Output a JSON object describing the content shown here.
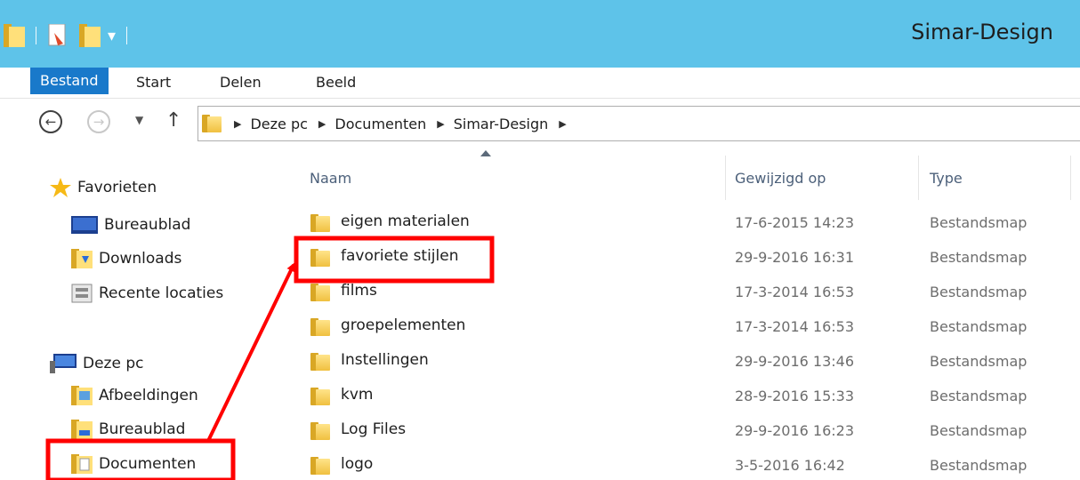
{
  "window": {
    "title": "Simar-Design"
  },
  "ribbon": {
    "tabs": [
      "Bestand",
      "Start",
      "Delen",
      "Beeld"
    ]
  },
  "address": {
    "crumbs": [
      "Deze pc",
      "Documenten",
      "Simar-Design"
    ]
  },
  "navpane": {
    "favorites_label": "Favorieten",
    "favorites": [
      "Bureaublad",
      "Downloads",
      "Recente locaties"
    ],
    "pc_label": "Deze pc",
    "pc_items": [
      "Afbeeldingen",
      "Bureaublad",
      "Documenten"
    ]
  },
  "columns": {
    "name": "Naam",
    "modified": "Gewijzigd op",
    "type": "Type"
  },
  "files": [
    {
      "name": "eigen materialen",
      "modified": "17-6-2015 14:23",
      "type": "Bestandsmap"
    },
    {
      "name": "favoriete stijlen",
      "modified": "29-9-2016 16:31",
      "type": "Bestandsmap"
    },
    {
      "name": "films",
      "modified": "17-3-2014 16:53",
      "type": "Bestandsmap"
    },
    {
      "name": "groepelementen",
      "modified": "17-3-2014 16:53",
      "type": "Bestandsmap"
    },
    {
      "name": "Instellingen",
      "modified": "29-9-2016 13:46",
      "type": "Bestandsmap"
    },
    {
      "name": "kvm",
      "modified": "28-9-2016 15:33",
      "type": "Bestandsmap"
    },
    {
      "name": "Log Files",
      "modified": "29-9-2016 16:23",
      "type": "Bestandsmap"
    },
    {
      "name": "logo",
      "modified": "3-5-2016 16:42",
      "type": "Bestandsmap"
    }
  ],
  "colors": {
    "titlebar": "#5ec3e9",
    "file_tab": "#1979ca",
    "highlight": "#ff0000"
  },
  "icons": {
    "back": "back-arrow-icon",
    "forward": "forward-arrow-icon",
    "up": "up-arrow-icon",
    "folder": "folder-icon",
    "star": "star-icon"
  }
}
